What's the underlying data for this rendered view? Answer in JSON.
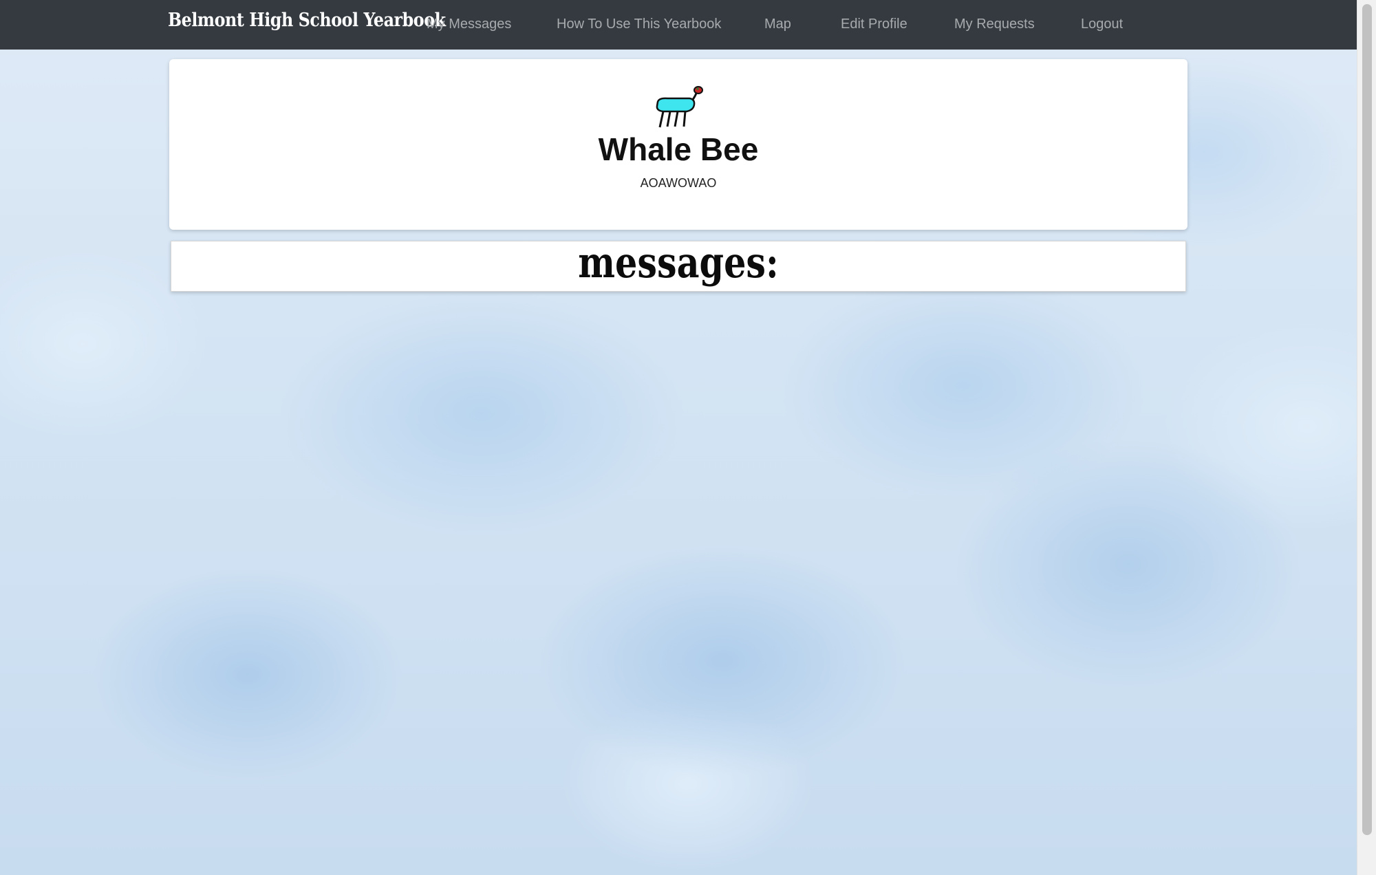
{
  "navbar": {
    "brand": "Belmont High School Yearbook",
    "items": [
      {
        "label": "My Messages"
      },
      {
        "label": "How To Use This Yearbook"
      },
      {
        "label": "Map"
      },
      {
        "label": "Edit Profile"
      },
      {
        "label": "My Requests"
      },
      {
        "label": "Logout"
      }
    ]
  },
  "profile": {
    "avatar_icon": "cyan-creature-drawing",
    "name": "Whale Bee",
    "subtitle": "AOAWOWAO"
  },
  "messages": {
    "heading": "messages:"
  },
  "colors": {
    "navbar_bg": "#343a40",
    "nav_text": "#a8abae",
    "brand_text": "#ffffff",
    "avatar_body": "#3ee4ee"
  }
}
